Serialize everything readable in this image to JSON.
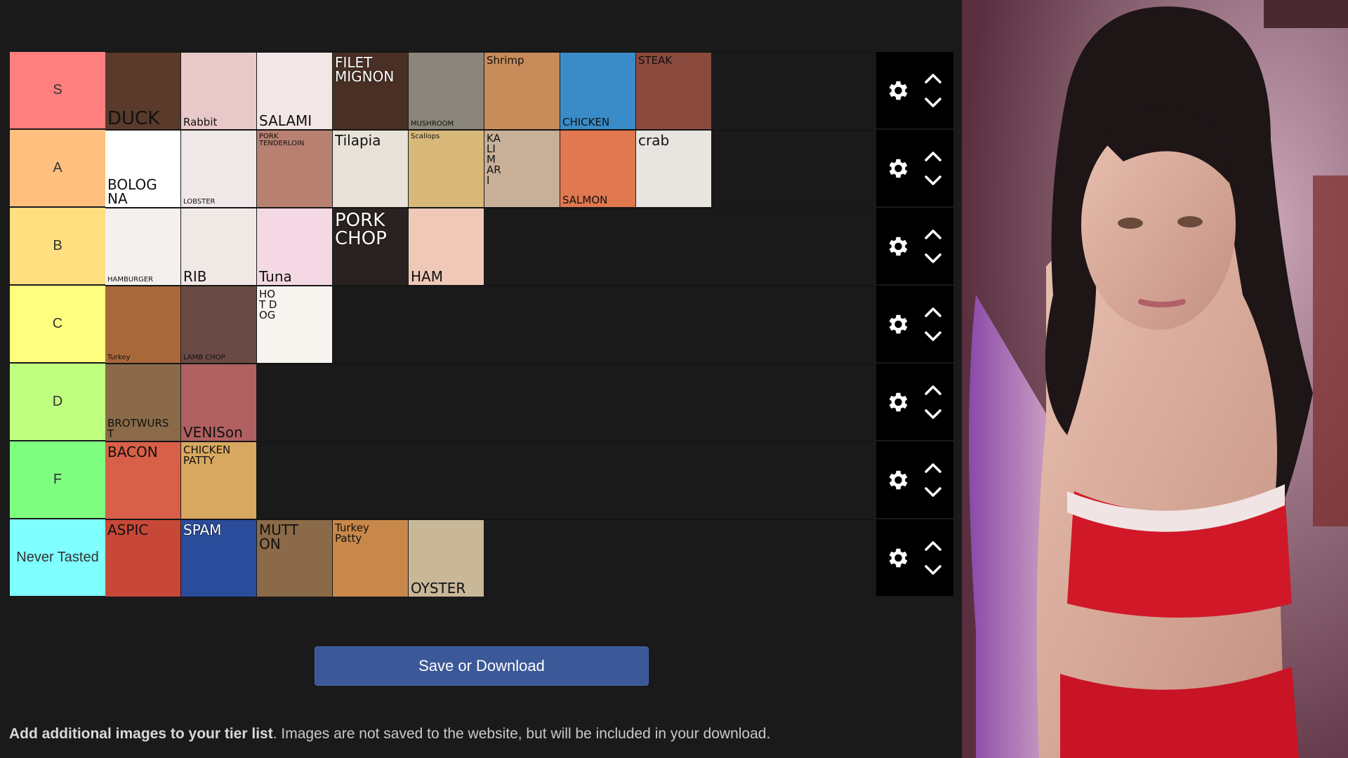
{
  "tiers": [
    {
      "label": "S",
      "color": "#ff7f7f",
      "items": [
        {
          "caption": "DUCK",
          "bg": "#5a3a2a",
          "size": "lg",
          "pos": "bottom"
        },
        {
          "caption": "Rabbit",
          "bg": "#e8c8c8",
          "size": "sm",
          "pos": "bottom"
        },
        {
          "caption": "SALAMI",
          "bg": "#f2e6e6",
          "size": "md",
          "pos": "bottom"
        },
        {
          "caption": "FILET\nMIGNON",
          "bg": "#4a3024",
          "size": "md",
          "pos": "top",
          "light": true
        },
        {
          "caption": "MUSHROOM",
          "bg": "#8a857a",
          "size": "xs",
          "pos": "bottom"
        },
        {
          "caption": "Shrimp",
          "bg": "#c88c5a",
          "size": "sm",
          "pos": "top"
        },
        {
          "caption": "CHICKEN",
          "bg": "#3a8cc8",
          "size": "sm",
          "pos": "bottom"
        },
        {
          "caption": "STEAK",
          "bg": "#8a4a3e",
          "size": "sm",
          "pos": "top"
        }
      ]
    },
    {
      "label": "A",
      "color": "#ffbf7f",
      "items": [
        {
          "caption": "BOLOG\nNA",
          "bg": "#ffffff",
          "size": "md",
          "pos": "bottom"
        },
        {
          "caption": "LOBSTER",
          "bg": "#f0e8e8",
          "size": "xs",
          "pos": "bottom"
        },
        {
          "caption": "PORK\nTENDERLOIN",
          "bg": "#b88070",
          "size": "xs",
          "pos": "top"
        },
        {
          "caption": "Tilapia",
          "bg": "#e8e2d8",
          "size": "md",
          "pos": "top"
        },
        {
          "caption": "Scallops",
          "bg": "#d8b878",
          "size": "xs",
          "pos": "top"
        },
        {
          "caption": "KA\nLI\nM\nAR\nI",
          "bg": "#c8b098",
          "size": "sm",
          "pos": "top"
        },
        {
          "caption": "SALMON",
          "bg": "#e07850",
          "size": "sm",
          "pos": "bottom"
        },
        {
          "caption": "crab",
          "bg": "#e8e4e0",
          "size": "md",
          "pos": "top"
        }
      ]
    },
    {
      "label": "B",
      "color": "#ffdf7f",
      "items": [
        {
          "caption": "HAMBURGER",
          "bg": "#f4f0ee",
          "size": "xs",
          "pos": "bottom"
        },
        {
          "caption": "RIB",
          "bg": "#f0e8e4",
          "size": "md",
          "pos": "bottom"
        },
        {
          "caption": "Tuna",
          "bg": "#f4d8e4",
          "size": "md",
          "pos": "bottom"
        },
        {
          "caption": "PORK\nCHOP",
          "bg": "#2a2220",
          "size": "lg",
          "pos": "top",
          "light": true
        },
        {
          "caption": "HAM",
          "bg": "#f0c8b8",
          "size": "md",
          "pos": "bottom"
        }
      ]
    },
    {
      "label": "C",
      "color": "#ffff7f",
      "items": [
        {
          "caption": "Turkey",
          "bg": "#a8683a",
          "size": "xs",
          "pos": "bottom"
        },
        {
          "caption": "LAMB CHOP",
          "bg": "#6a4a44",
          "size": "xs",
          "pos": "bottom"
        },
        {
          "caption": "HO\nT D\nOG",
          "bg": "#f8f4f0",
          "size": "sm",
          "pos": "top"
        }
      ]
    },
    {
      "label": "D",
      "color": "#bfff7f",
      "items": [
        {
          "caption": "BROTWURS\nT",
          "bg": "#8a6a48",
          "size": "sm",
          "pos": "bottom"
        },
        {
          "caption": "VENISon",
          "bg": "#b06060",
          "size": "md",
          "pos": "bottom"
        }
      ]
    },
    {
      "label": "F",
      "color": "#7fff7f",
      "items": [
        {
          "caption": "BACON",
          "bg": "#d86048",
          "size": "md",
          "pos": "top"
        },
        {
          "caption": "CHICKEN\nPATTY",
          "bg": "#d8a860",
          "size": "sm",
          "pos": "top"
        }
      ]
    },
    {
      "label": "Never Tasted",
      "color": "#7fffff",
      "items": [
        {
          "caption": "ASPIC",
          "bg": "#c84838",
          "size": "md",
          "pos": "top"
        },
        {
          "caption": "SPAM",
          "bg": "#2a4c9a",
          "size": "md",
          "pos": "top",
          "light": true
        },
        {
          "caption": "MUTT\nON",
          "bg": "#8a6a48",
          "size": "md",
          "pos": "top"
        },
        {
          "caption": "Turkey\nPatty",
          "bg": "#c8884a",
          "size": "sm",
          "pos": "top"
        },
        {
          "caption": "OYSTER",
          "bg": "#c8b898",
          "size": "md",
          "pos": "bottom"
        }
      ]
    }
  ],
  "save_button_label": "Save or Download",
  "footer": {
    "bold": "Add additional images to your tier list",
    "rest": ". Images are not saved to the website, but will be included in your download."
  },
  "icons": {
    "settings": "gear-icon",
    "up": "chevron-up-icon",
    "down": "chevron-down-icon"
  }
}
